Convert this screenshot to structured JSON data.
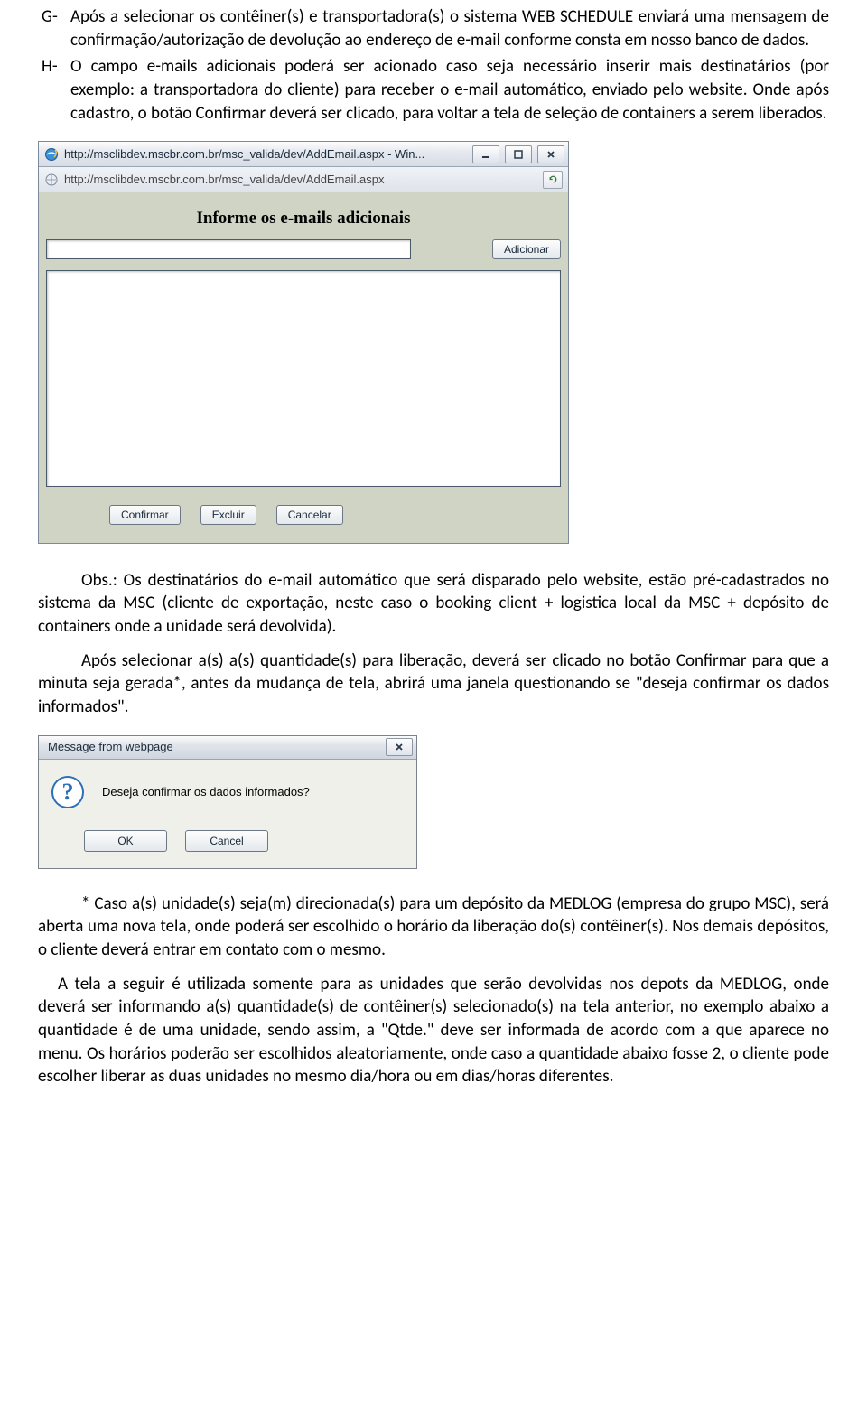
{
  "doc": {
    "items": {
      "g": {
        "marker": "G-",
        "text": "Após a selecionar os contêiner(s) e transportadora(s) o sistema WEB SCHEDULE enviará uma mensagem de confirmação/autorização de devolução ao endereço de e-mail conforme consta em nosso banco de dados."
      },
      "h": {
        "marker": "H-",
        "text": "O campo e-mails adicionais poderá ser acionado caso seja necessário inserir mais destinatários (por exemplo: a transportadora do cliente) para receber o e-mail automático, enviado pelo website. Onde após cadastro, o botão Confirmar deverá ser clicado, para voltar a tela de seleção de containers a serem liberados."
      }
    },
    "obs": "Obs.: Os destinatários do e-mail automático que será disparado pelo website, estão pré-cadastrados no sistema da MSC (cliente de exportação, neste caso o booking client + logistica local da MSC + depósito de containers onde a unidade será devolvida).",
    "p2": "Após selecionar a(s) a(s) quantidade(s) para liberação, deverá ser clicado no botão Confirmar para que a minuta seja gerada*, antes da mudança de tela, abrirá uma janela questionando se \"deseja confirmar os dados  informados\".",
    "note": "* Caso a(s) unidade(s) seja(m) direcionada(s) para um depósito da MEDLOG (empresa do grupo MSC), será aberta uma nova tela, onde poderá ser escolhido o horário da liberação do(s) contêiner(s). Nos demais depósitos, o cliente deverá entrar em contato com o mesmo.",
    "p3": "A tela a seguir é utilizada somente para as unidades que serão devolvidas nos depots da MEDLOG, onde deverá ser informando a(s) quantidade(s) de contêiner(s) selecionado(s) na tela anterior, no exemplo abaixo a quantidade é de uma unidade, sendo assim, a \"Qtde.\" deve ser informada de acordo com a que aparece no menu. Os horários poderão ser escolhidos aleatoriamente, onde caso a quantidade abaixo fosse 2, o cliente pode escolher liberar as duas unidades no mesmo dia/hora ou em dias/horas diferentes."
  },
  "window": {
    "title": "http://msclibdev.mscbr.com.br/msc_valida/dev/AddEmail.aspx - Win...",
    "url": "http://msclibdev.mscbr.com.br/msc_valida/dev/AddEmail.aspx",
    "heading": "Informe os e-mails adicionais",
    "buttons": {
      "add": "Adicionar",
      "confirm": "Confirmar",
      "delete": "Excluir",
      "cancel": "Cancelar"
    }
  },
  "dialog": {
    "title": "Message from webpage",
    "text": "Deseja confirmar os dados informados?",
    "ok": "OK",
    "cancel": "Cancel"
  }
}
